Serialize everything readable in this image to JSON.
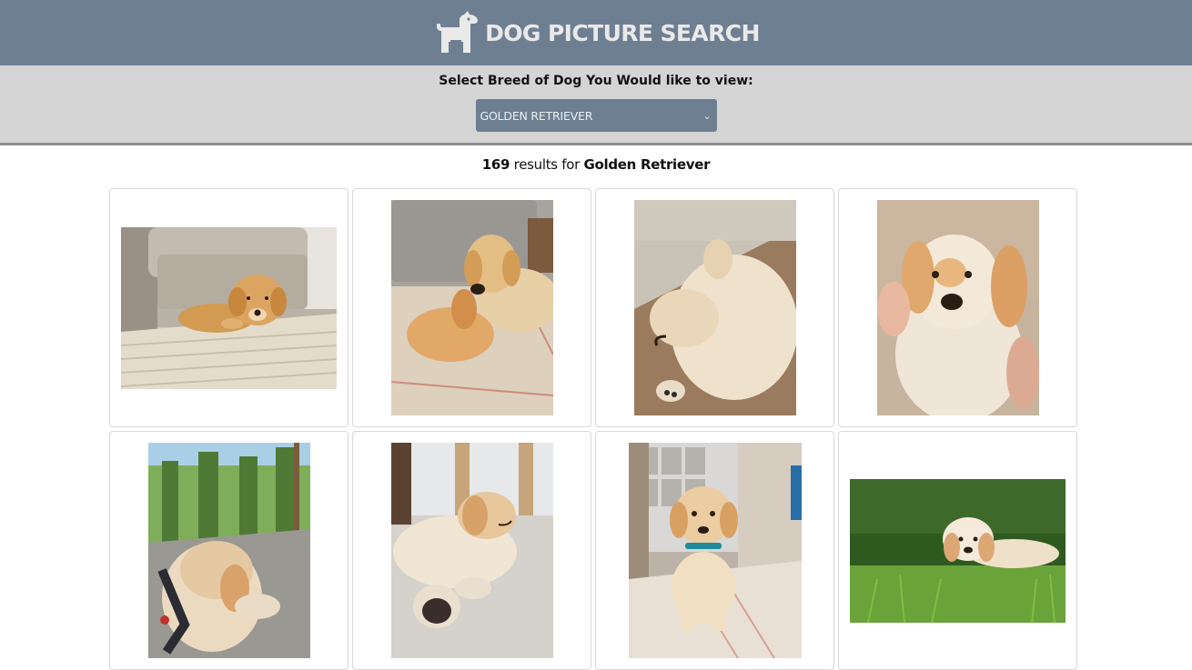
{
  "header": {
    "title": "DOG PICTURE SEARCH",
    "logo_icon": "dog-icon"
  },
  "controls": {
    "label": "Select Breed of Dog You Would like to view:",
    "selected_breed": "GOLDEN RETRIEVER"
  },
  "results": {
    "count": "169",
    "middle": " results for ",
    "breed": "Golden Retriever"
  },
  "colors": {
    "header_bg": "#6e7f92",
    "controls_bg": "#d4d4d4",
    "select_bg": "#6e7f92"
  },
  "photos": [
    {
      "subject": "puppy lying on rug near couch"
    },
    {
      "subject": "puppy chewing toy on mat"
    },
    {
      "subject": "puppy sleeping against couch"
    },
    {
      "subject": "puppy held in hands"
    },
    {
      "subject": "puppy in harness outdoors by forest"
    },
    {
      "subject": "puppy sleeping on wood floor"
    },
    {
      "subject": "puppy standing on rug"
    },
    {
      "subject": "puppy lying in grass"
    }
  ]
}
